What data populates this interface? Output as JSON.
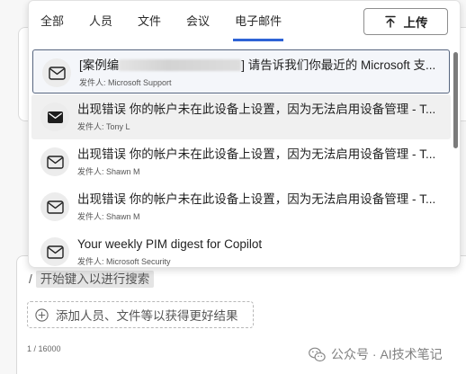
{
  "tabs": [
    {
      "label": "全部"
    },
    {
      "label": "人员"
    },
    {
      "label": "文件"
    },
    {
      "label": "会议"
    },
    {
      "label": "电子邮件",
      "active": true
    }
  ],
  "upload": {
    "label": "上传",
    "icon": "upload-icon"
  },
  "emails": [
    {
      "title_prefix": "[案例编",
      "title_suffix": "] 请告诉我们你最近的 Microsoft 支...",
      "sender": "发件人: Microsoft Support",
      "icon": "envelope-outline-icon",
      "selected": true
    },
    {
      "title": "出现错误 你的帐户未在此设备上设置，因为无法启用设备管理 - T...",
      "sender": "发件人: Tony L",
      "icon": "envelope-filled-icon",
      "hovered": true
    },
    {
      "title": "出现错误 你的帐户未在此设备上设置，因为无法启用设备管理 - T...",
      "sender": "发件人: Shawn M",
      "icon": "envelope-outline-icon"
    },
    {
      "title": "出现错误 你的帐户未在此设备上设置，因为无法启用设备管理 - T...",
      "sender": "发件人: Shawn M",
      "icon": "envelope-outline-icon"
    },
    {
      "title": "Your weekly PIM digest for Copilot",
      "sender": "发件人: Microsoft Security",
      "icon": "envelope-outline-icon"
    }
  ],
  "composer": {
    "prefix": "/",
    "placeholder": "开始键入以进行搜索",
    "add_context_label": "添加人员、文件等以获得更好结果",
    "add_context_icon": "add-circle-icon",
    "char_counter": "1 / 16000"
  },
  "watermark": {
    "text": "公众号 · AI技术笔记",
    "icon": "wechat-icon"
  },
  "colors": {
    "accent": "#2f63d6",
    "selected_border": "#56657f",
    "selected_bg": "#f4f6fa",
    "hover_bg": "#f0f0f0"
  }
}
